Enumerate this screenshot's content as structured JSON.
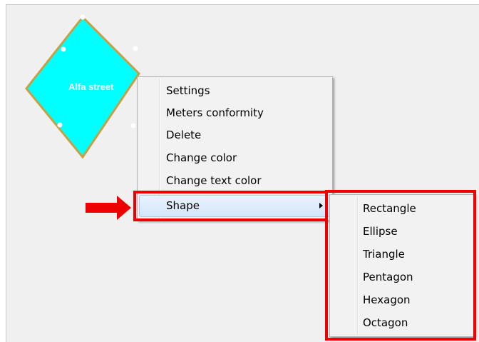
{
  "node": {
    "label": "Alfa street",
    "fill": "#00ffff",
    "border": "#c8a040"
  },
  "context_menu": {
    "items": [
      {
        "label": "Settings"
      },
      {
        "label": "Meters conformity"
      },
      {
        "label": "Delete"
      },
      {
        "label": "Change color"
      },
      {
        "label": "Change text color"
      },
      {
        "label": "Shape",
        "has_submenu": true,
        "highlighted": true
      }
    ]
  },
  "shape_submenu": {
    "items": [
      {
        "label": "Rectangle"
      },
      {
        "label": "Ellipse"
      },
      {
        "label": "Triangle"
      },
      {
        "label": "Pentagon"
      },
      {
        "label": "Hexagon"
      },
      {
        "label": "Octagon"
      }
    ]
  },
  "colors": {
    "highlight": "#ee0000",
    "menu_bg": "#f2f2f2"
  }
}
